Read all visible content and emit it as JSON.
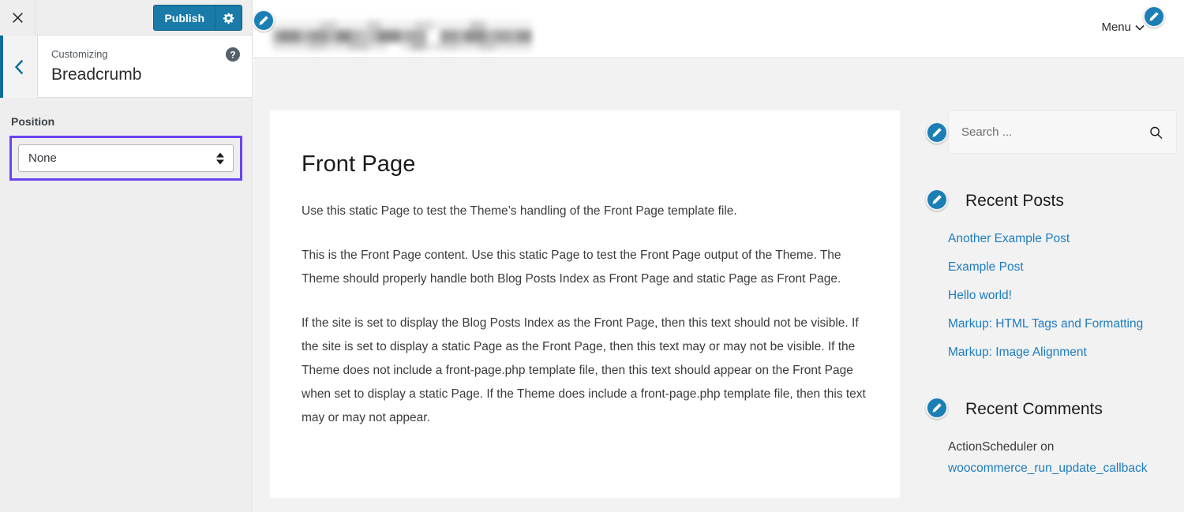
{
  "customizer": {
    "close_icon": "close-icon",
    "publish_label": "Publish",
    "gear_icon": "gear-icon",
    "back_icon": "chevron-left-icon",
    "eyebrow": "Customizing",
    "title": "Breadcrumb",
    "help_icon": "help-icon",
    "control": {
      "label": "Position",
      "selected_value": "None",
      "options": [
        "None"
      ]
    },
    "accent_color": "#0b6d9e",
    "publish_color": "#1a7aa8",
    "focus_outline_color": "#6a45f0"
  },
  "preview": {
    "header": {
      "logo": "site-logo-blurred",
      "menu_label": "Menu",
      "chevron_icon": "chevron-down-icon"
    },
    "edit_pencil_icon": "pencil-edit-icon",
    "content": {
      "heading": "Front Page",
      "paragraphs": [
        "Use this static Page to test the Theme’s handling of the Front Page template file.",
        "This is the Front Page content. Use this static Page to test the Front Page output of the Theme. The Theme should properly handle both Blog Posts Index as Front Page and static Page as Front Page.",
        "If the site is set to display the Blog Posts Index as the Front Page, then this text should not be visible. If the site is set to display a static Page as the Front Page, then this text may or may not be visible. If the Theme does not include a front-page.php template file, then this text should appear on the Front Page when set to display a static Page. If the Theme does include a front-page.php template file, then this text may or may not appear."
      ]
    },
    "widgets": {
      "search": {
        "placeholder": "Search ...",
        "icon": "search-icon"
      },
      "recent_posts": {
        "title": "Recent Posts",
        "items": [
          "Another Example Post",
          "Example Post",
          "Hello world!",
          "Markup: HTML Tags and Formatting",
          "Markup: Image Alignment"
        ]
      },
      "recent_comments": {
        "title": "Recent Comments",
        "items": [
          {
            "author": "ActionScheduler on",
            "link": "woocommerce_run_update_callback"
          }
        ]
      }
    },
    "link_color": "#1d7cc0"
  }
}
